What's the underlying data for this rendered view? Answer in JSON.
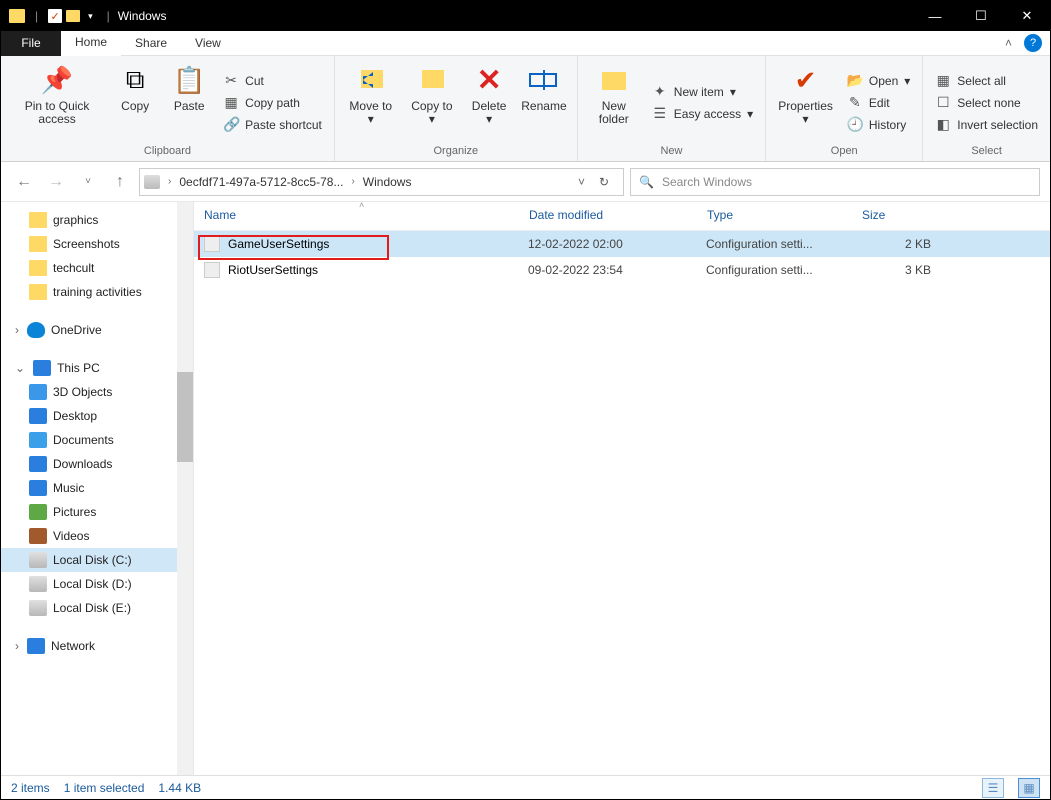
{
  "window": {
    "title": "Windows"
  },
  "menubar": {
    "file": "File",
    "home": "Home",
    "share": "Share",
    "view": "View"
  },
  "ribbon": {
    "clipboard": {
      "label": "Clipboard",
      "pin": "Pin to Quick access",
      "copy": "Copy",
      "paste": "Paste",
      "cut": "Cut",
      "copypath": "Copy path",
      "pasteshort": "Paste shortcut"
    },
    "organize": {
      "label": "Organize",
      "moveto": "Move to",
      "copyto": "Copy to",
      "delete": "Delete",
      "rename": "Rename"
    },
    "new": {
      "label": "New",
      "newfolder": "New folder",
      "newitem": "New item",
      "easyaccess": "Easy access"
    },
    "open": {
      "label": "Open",
      "properties": "Properties",
      "open": "Open",
      "edit": "Edit",
      "history": "History"
    },
    "select": {
      "label": "Select",
      "all": "Select all",
      "none": "Select none",
      "invert": "Invert selection"
    }
  },
  "address": {
    "seg1": "0ecfdf71-497a-5712-8cc5-78...",
    "seg2": "Windows"
  },
  "search": {
    "placeholder": "Search Windows"
  },
  "columns": {
    "name": "Name",
    "date": "Date modified",
    "type": "Type",
    "size": "Size"
  },
  "files": [
    {
      "name": "GameUserSettings",
      "date": "12-02-2022 02:00",
      "type": "Configuration setti...",
      "size": "2 KB"
    },
    {
      "name": "RiotUserSettings",
      "date": "09-02-2022 23:54",
      "type": "Configuration setti...",
      "size": "3 KB"
    }
  ],
  "tree": {
    "graphics": "graphics",
    "screenshots": "Screenshots",
    "techcult": "techcult",
    "training": "training activities",
    "onedrive": "OneDrive",
    "thispc": "This PC",
    "objects": "3D Objects",
    "desktop": "Desktop",
    "documents": "Documents",
    "downloads": "Downloads",
    "music": "Music",
    "pictures": "Pictures",
    "videos": "Videos",
    "diskc": "Local Disk (C:)",
    "diskd": "Local Disk (D:)",
    "diske": "Local Disk (E:)",
    "network": "Network"
  },
  "status": {
    "items": "2 items",
    "selected": "1 item selected",
    "size": "1.44 KB"
  }
}
